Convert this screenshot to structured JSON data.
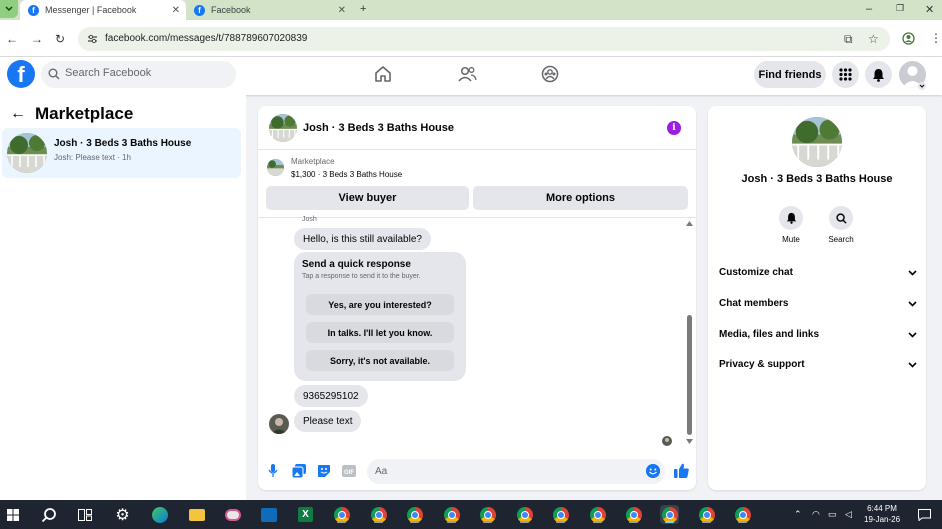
{
  "browser": {
    "tabs": [
      {
        "title": "Messenger | Facebook",
        "active": true,
        "icon": "facebook-icon"
      },
      {
        "title": "Facebook",
        "active": false,
        "icon": "facebook-icon"
      }
    ],
    "url": "facebook.com/messages/t/788789607020839"
  },
  "fb_header": {
    "search_placeholder": "Search Facebook",
    "find_friends_label": "Find friends",
    "brand_color": "#1877f2"
  },
  "left_panel": {
    "title": "Marketplace",
    "conversations": [
      {
        "title": "Josh · 3 Beds 3 Baths House",
        "preview": "Josh: Please text · 1h",
        "selected": true
      }
    ]
  },
  "chat": {
    "title": "Josh · 3 Beds 3 Baths House",
    "listing": {
      "label": "Marketplace",
      "detail": "$1,300 · 3 Beds 3 Baths House",
      "buttons": [
        "View buyer",
        "More options"
      ]
    },
    "sender_name": "Josh",
    "messages": {
      "first": "Hello, is this still available?",
      "phone": "9365295102",
      "last": "Please text"
    },
    "quick_response": {
      "heading": "Send a quick response",
      "subheading": "Tap a response to send it to the buyer.",
      "options": [
        "Yes, are you interested?",
        "In talks. I'll let you know.",
        "Sorry, it's not available."
      ]
    },
    "composer_placeholder": "Aa"
  },
  "right_panel": {
    "name": "Josh · 3 Beds 3 Baths House",
    "actions": [
      {
        "label": "Mute",
        "icon": "bell-icon"
      },
      {
        "label": "Search",
        "icon": "search-icon"
      }
    ],
    "sections": [
      "Customize chat",
      "Chat members",
      "Media, files and links",
      "Privacy & support"
    ]
  },
  "taskbar": {
    "time": "6:44 PM",
    "date": "19-Jan-26"
  }
}
